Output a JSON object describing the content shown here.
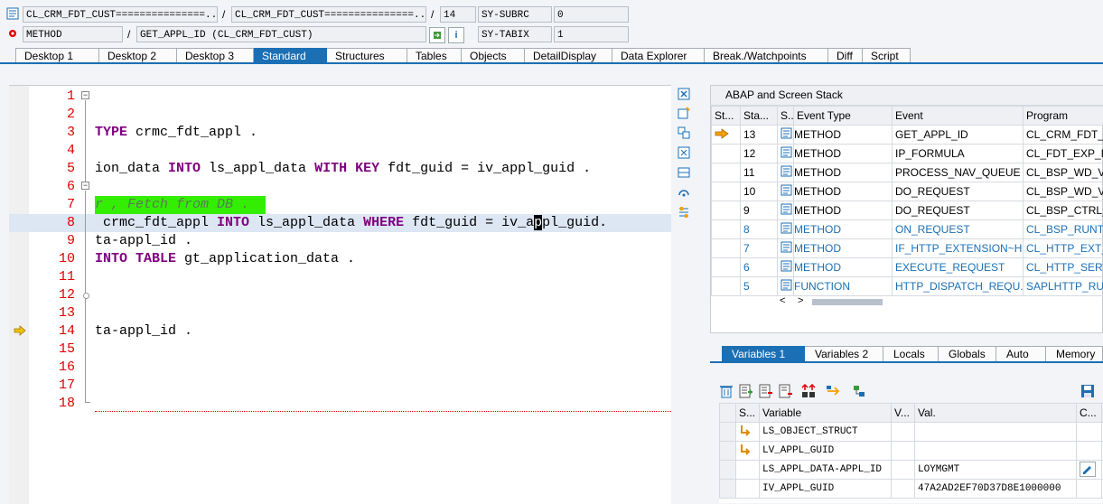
{
  "header": {
    "program_field": "CL_CRM_FDT_CUST===============...",
    "include_field": "CL_CRM_FDT_CUST===============...",
    "line_field": "14",
    "sy_subrc_label": "SY-SUBRC",
    "sy_subrc_value": "0",
    "event_type_field": "METHOD",
    "event_field": "GET_APPL_ID (CL_CRM_FDT_CUST)",
    "sy_tabix_label": "SY-TABIX",
    "sy_tabix_value": "1",
    "slash": "/"
  },
  "tabs": [
    "Desktop 1",
    "Desktop 2",
    "Desktop 3",
    "Standard",
    "Structures",
    "Tables",
    "Objects",
    "DetailDisplay",
    "Data Explorer",
    "Break./Watchpoints",
    "Diff",
    "Script"
  ],
  "active_tab": "Standard",
  "editor": {
    "line_numbers": [
      "1",
      "2",
      "3",
      "4",
      "5",
      "6",
      "7",
      "8",
      "9",
      "10",
      "11",
      "12",
      "13",
      "14",
      "15",
      "16",
      "17",
      "18"
    ],
    "current_line": "14",
    "lines": {
      "l3_kw": "TYPE",
      "l3_rest": " crmc_fdt_appl .",
      "l5_a": "ion_data ",
      "l5_kw1": "INTO",
      "l5_b": " ls_appl_data ",
      "l5_kw2": "WITH KEY",
      "l5_c": " fdt_guid = iv_appl_guid .",
      "l7_comment": "r , Fetch from DB .",
      "l8_a": " crmc_fdt_appl ",
      "l8_kw1": "INTO",
      "l8_b": " ls_appl_data ",
      "l8_kw2": "WHERE",
      "l8_c": " fdt_guid = iv_a",
      "l8_cursor": "p",
      "l8_d": "pl_guid.",
      "l9": "ta-appl_id .",
      "l10_kw": "INTO TABLE",
      "l10_rest": " gt_application_data .",
      "l14": "ta-appl_id ."
    }
  },
  "stack": {
    "title": "ABAP and Screen Stack",
    "columns": [
      "St...",
      "Sta...",
      "S...",
      "Event Type",
      "Event",
      "Program"
    ],
    "rows": [
      {
        "level": "13",
        "type": "METHOD",
        "event": "GET_APPL_ID",
        "program": "CL_CRM_FDT_C",
        "current": true,
        "blue": false
      },
      {
        "level": "12",
        "type": "METHOD",
        "event": "IP_FORMULA",
        "program": "CL_FDT_EXP_FO",
        "current": false,
        "blue": false
      },
      {
        "level": "11",
        "type": "METHOD",
        "event": "PROCESS_NAV_QUEUE",
        "program": "CL_BSP_WD_VI",
        "current": false,
        "blue": false
      },
      {
        "level": "10",
        "type": "METHOD",
        "event": "DO_REQUEST",
        "program": "CL_BSP_WD_VI",
        "current": false,
        "blue": false
      },
      {
        "level": "9",
        "type": "METHOD",
        "event": "DO_REQUEST",
        "program": "CL_BSP_CTRL_A",
        "current": false,
        "blue": false
      },
      {
        "level": "8",
        "type": "METHOD",
        "event": "ON_REQUEST",
        "program": "CL_BSP_RUNTIN",
        "current": false,
        "blue": true
      },
      {
        "level": "7",
        "type": "METHOD",
        "event": "IF_HTTP_EXTENSION~H...",
        "program": "CL_HTTP_EXT_",
        "current": false,
        "blue": true
      },
      {
        "level": "6",
        "type": "METHOD",
        "event": "EXECUTE_REQUEST",
        "program": "CL_HTTP_SERV",
        "current": false,
        "blue": true
      },
      {
        "level": "5",
        "type": "FUNCTION",
        "event": "HTTP_DISPATCH_REQU...",
        "program": "SAPLHTTP_RUN",
        "current": false,
        "blue": true
      }
    ]
  },
  "var_tabs": [
    "Variables 1",
    "Variables 2",
    "Locals",
    "Globals",
    "Auto",
    "Memory"
  ],
  "active_var_tab": "Variables 1",
  "variables": {
    "columns": [
      "S...",
      "Variable",
      "V...",
      "Val.",
      "C..."
    ],
    "rows": [
      {
        "variable": "LS_OBJECT_STRUCT",
        "value": "",
        "has_icon": true
      },
      {
        "variable": "LV_APPL_GUID",
        "value": "",
        "has_icon": true
      },
      {
        "variable": "LS_APPL_DATA-APPL_ID",
        "value": "LOYMGMT",
        "has_icon": false
      },
      {
        "variable": "IV_APPL_GUID",
        "value": "47A2AD2EF70D37D8E1000000",
        "has_icon": false
      }
    ]
  },
  "colors": {
    "accent": "#1b6fb5",
    "line_number": "#e00000",
    "keyword": "#7f007f",
    "highlight_green": "#33ee00",
    "current_line_bg": "#dde6f3"
  }
}
